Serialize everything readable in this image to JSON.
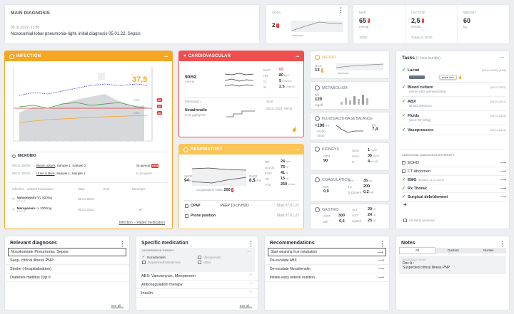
{
  "main_diagnosis": {
    "title": "MAIN DIAGNOSIS",
    "date": "05.01.2022, 13:50",
    "text": "Nosocomial lobar pneumonia-right, initial diagnosis 05.01.22. Sepsis"
  },
  "sofa": {
    "label": "SOFA",
    "value": "2",
    "caption": "Admission"
  },
  "vitals": [
    {
      "label": "MAP",
      "value": "65",
      "unit": "mmHg",
      "sub": "10/52"
    },
    {
      "label": "LACTATE",
      "value": "2,5",
      "unit": "mmol/L",
      "sub": "Today at 10:00"
    },
    {
      "label": "WEIGHT",
      "value": "60",
      "unit": "kg",
      "sub": ""
    }
  ],
  "infection": {
    "title": "INFECTION",
    "temp": "37,5",
    "temp_unit": "°C",
    "markers": [
      {
        "k": "CRP",
        "v": "60"
      },
      {
        "k": "PCT",
        "v": "10"
      },
      {
        "k": "WBC",
        "v": "10"
      }
    ],
    "microbio_title": "MICROBIO",
    "microbio": [
      {
        "date": "05.01. 09:05",
        "name": "Blood culture",
        "sample": "Sample 1, Sample 2",
        "result": "St.aureus",
        "flag": "NEW"
      },
      {
        "date": "05.01. 09:05",
        "name": "Urine culture",
        "sample": "Sample 1, Sample 2",
        "result": "In progress",
        "flag": ""
      }
    ],
    "med_cols": [
      "Infection - related medication",
      "Start",
      "End",
      "Etiotropic"
    ],
    "meds": [
      {
        "name": "Vancomycin",
        "dose": "IVL 500mg",
        "freq": "1-0-1-0",
        "start": "05.01.2022",
        "end": "",
        "etio": ""
      },
      {
        "name": "Meropenem",
        "dose": "i.v 1000mg",
        "freq": "1-0-1-0",
        "start": "05.01.2022",
        "end": "",
        "etio": "✔"
      }
    ],
    "link": "Infection - related medication"
  },
  "cardio": {
    "title": "CARDIOVASCULAR",
    "bp": "90/52",
    "bp_unit": "mmHg",
    "rows": [
      {
        "k": "MAP",
        "v": "65"
      },
      {
        "k": "HR",
        "v": "80",
        "u": "bpm"
      },
      {
        "k": "CI",
        "v": "5",
        "u": "L/min/m²"
      },
      {
        "k": "SI",
        "v": "2.5",
        "u": "L/min/m²"
      }
    ],
    "med_label": "Medication",
    "start_label": "Start",
    "med_name": "Noradrenalin",
    "med_dose": "0,15 µg/kg/min",
    "med_start": "05.01.2022, 09:00"
  },
  "resp": {
    "title": "RESPIRATORY",
    "spo2_label": "SpO2",
    "spo2": "94",
    "spo2_unit": "%",
    "pao2_label": "PaO2",
    "pao2": "8,5",
    "pao2_unit": "kPa",
    "oxy_label": "Oxygenation index",
    "oxy": "200",
    "rows": [
      {
        "k": "RR",
        "v": "24",
        "u": "/min"
      },
      {
        "k": "ScvO2",
        "v": "75",
        "u": "%"
      },
      {
        "k": "FiO2",
        "v": "41",
        "u": "%"
      },
      {
        "k": "VE",
        "v": "15",
        "u": "mL"
      },
      {
        "k": "VT2",
        "v": "250",
        "u": "ml/min"
      }
    ],
    "cpap": "CPAP",
    "peep": "PEEP 10 cm H2O",
    "cpap_start": "Start 07.01.22",
    "prone": "Prone position",
    "prone_start": "Start 07.01.22"
  },
  "neuro": {
    "title": "NEURO",
    "gcs": "13",
    "caption": "Admission"
  },
  "metabolism": {
    "title": "METABOLISM",
    "label": "BS",
    "value": "120",
    "unit": "mg/dl"
  },
  "fluids": {
    "title": "FLUIDS/ACID-BASE BALANCE",
    "bal": "+100",
    "bal_unit": "ml",
    "in": "+2100",
    "out": "-2000",
    "ph_label": "pH",
    "ph": "7,4"
  },
  "kidneys": {
    "title": "KIDNEYS",
    "gfr_label": "GFR",
    "gfr": "90",
    "rows": [
      {
        "k": "Crea",
        "v": "1",
        "u": "mg/dl"
      },
      {
        "k": "Urea",
        "v": "35",
        "u": "mg/dl"
      },
      {
        "k": "K+",
        "v": "4",
        "u": "mmol/l"
      }
    ]
  },
  "coag": {
    "title": "COAGULATION",
    "inr_label": "INR",
    "inr": "0,9",
    "rows": [
      {
        "k": "PTT",
        "v": "35",
        "u": "sec"
      },
      {
        "k": "TC",
        "v": "200",
        "u": ""
      },
      {
        "k": "D-Dimere",
        "v": "0,2",
        "u": "µg/l"
      }
    ]
  },
  "gastro": {
    "title": "GASTRO",
    "left": [
      {
        "k": "GGT",
        "v": "300"
      },
      {
        "k": "Bili",
        "v": "0,5"
      }
    ],
    "rows": [
      {
        "k": "ALT",
        "v": "20",
        "u": "U/l"
      },
      {
        "k": "AST",
        "v": "24",
        "u": "U/l"
      },
      {
        "k": "Lipase",
        "v": "25",
        "u": "U/l"
      }
    ]
  },
  "tasks": {
    "title": "Tasks",
    "subtitle": "(1-hour bundle)",
    "items": [
      {
        "name": "Lactat",
        "sub": "",
        "date": "(05.01.2022) (4:05)",
        "chip": "more info"
      },
      {
        "name": "Blood culture",
        "sub": "before ABX administration",
        "date": "(05.01.2022)"
      },
      {
        "name": "ABX",
        "sub": "Broad spectrum",
        "date": "(05.01.2022)"
      },
      {
        "name": "Fluids",
        "sub": "(bzol: 30 ml/kg)",
        "date": "(05.01.2022)"
      },
      {
        "name": "Vasopressors",
        "sub": "",
        "date": "(05.01.2022)"
      }
    ],
    "add_title": "ADDITIONAL DIAGNOSTICS/THERAPY",
    "add": [
      {
        "name": "ECHO",
        "done": false,
        "note": ""
      },
      {
        "name": "CT Abdomen",
        "done": false,
        "note": ""
      },
      {
        "name": "EMG",
        "done": true,
        "note": "(booked 11.01.2022)"
      },
      {
        "name": "Rx Thorax",
        "done": true,
        "note": ""
      },
      {
        "name": "Surgical debridement",
        "done": true,
        "note": ""
      }
    ],
    "footer": "All alerts resolved"
  },
  "diagnoses": {
    "title": "Relevant diagnoses",
    "items": [
      "Nosokomiale Pneumonia. Sepsis",
      "Susp. critical illness PNP",
      "Stroke (-hospitalisation)",
      "Diabetes mellitus Typ II"
    ],
    "see_all": "See all..."
  },
  "specmed": {
    "title": "Specific medication",
    "group": "VASOPRESSIVE THERAPY",
    "opts": [
      "Noradrenalin",
      "Vasopressin",
      "Dopamine/Dobutamine",
      "other"
    ],
    "items": [
      "ABX: Vancomycin, Meropenem",
      "Anticoagulation therapy",
      "Insulin"
    ],
    "see_all": "See all..."
  },
  "recs": {
    "title": "Recommendations",
    "items": [
      "Start weaning from intubation",
      "De-escalate ABX",
      "De-escalate Noradrenalin",
      "Initiate early enteral nutrition"
    ]
  },
  "notes": {
    "title": "Notes",
    "tabs": [
      "All",
      "Doctors",
      "Nurses"
    ],
    "date": "05.01.2022, 04:00",
    "author": "Doc A.:",
    "text": "Suspected critical illness PNP"
  },
  "colors": {
    "orange": "#f5a623",
    "red": "#ef4f4f",
    "yellow": "#fbc456"
  }
}
